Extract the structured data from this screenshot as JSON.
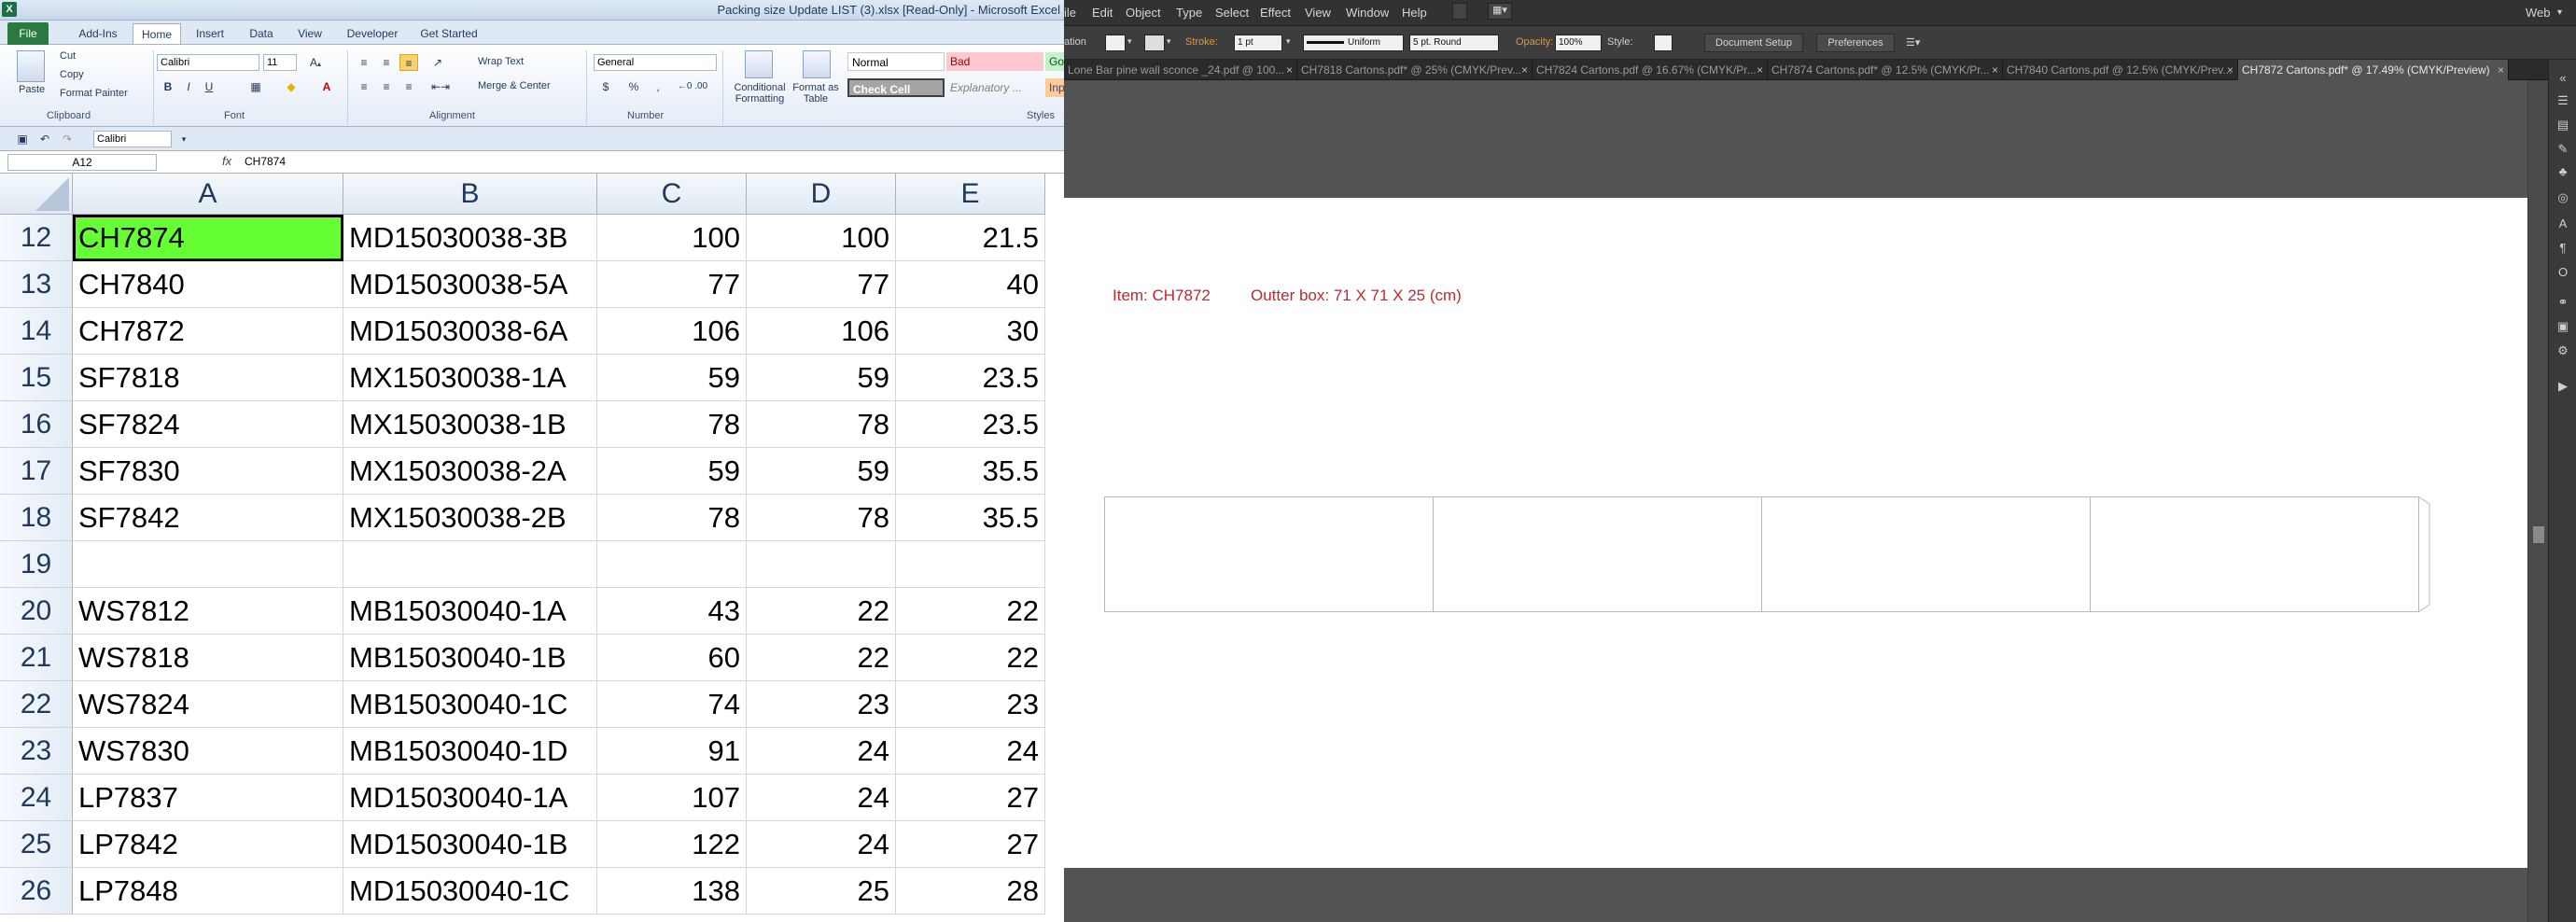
{
  "excel": {
    "window_title": "Packing size Update LIST (3).xlsx  [Read-Only]  -  Microsoft Excel",
    "tabs": [
      "File",
      "Add-Ins",
      "Home",
      "Insert",
      "Data",
      "View",
      "Developer",
      "Get Started"
    ],
    "active_tab": "Home",
    "ribbon": {
      "clipboard": {
        "paste": "Paste",
        "cut": "Cut",
        "copy": "Copy",
        "format_painter": "Format Painter",
        "label": "Clipboard"
      },
      "font": {
        "name": "Calibri",
        "size": "11",
        "label": "Font"
      },
      "alignment": {
        "wrap_text": "Wrap Text",
        "merge_center": "Merge & Center",
        "label": "Alignment"
      },
      "number": {
        "format": "General",
        "currency": "$",
        "percent": "%",
        "comma": ",",
        "label": "Number"
      },
      "styles": {
        "conditional": "Conditional Formatting",
        "format_table": "Format as Table",
        "normal": "Normal",
        "bad": "Bad",
        "good": "Go",
        "check_cell": "Check Cell",
        "explanatory": "Explanatory ...",
        "input": "Inp",
        "label": "Styles"
      }
    },
    "qat_font": "Calibri",
    "name_box": "A12",
    "fx_label": "fx",
    "formula_value": "CH7874",
    "columns": [
      "A",
      "B",
      "C",
      "D",
      "E"
    ],
    "rows": [
      {
        "num": "12",
        "a": "CH7874",
        "b": "MD15030038-3B",
        "c": "100",
        "d": "100",
        "e": "21.5"
      },
      {
        "num": "13",
        "a": "CH7840",
        "b": "MD15030038-5A",
        "c": "77",
        "d": "77",
        "e": "40"
      },
      {
        "num": "14",
        "a": "CH7872",
        "b": "MD15030038-6A",
        "c": "106",
        "d": "106",
        "e": "30"
      },
      {
        "num": "15",
        "a": "SF7818",
        "b": "MX15030038-1A",
        "c": "59",
        "d": "59",
        "e": "23.5"
      },
      {
        "num": "16",
        "a": "SF7824",
        "b": "MX15030038-1B",
        "c": "78",
        "d": "78",
        "e": "23.5"
      },
      {
        "num": "17",
        "a": "SF7830",
        "b": "MX15030038-2A",
        "c": "59",
        "d": "59",
        "e": "35.5"
      },
      {
        "num": "18",
        "a": "SF7842",
        "b": "MX15030038-2B",
        "c": "78",
        "d": "78",
        "e": "35.5"
      },
      {
        "num": "19",
        "a": "",
        "b": "",
        "c": "",
        "d": "",
        "e": ""
      },
      {
        "num": "20",
        "a": "WS7812",
        "b": "MB15030040-1A",
        "c": "43",
        "d": "22",
        "e": "22"
      },
      {
        "num": "21",
        "a": "WS7818",
        "b": "MB15030040-1B",
        "c": "60",
        "d": "22",
        "e": "22"
      },
      {
        "num": "22",
        "a": "WS7824",
        "b": "MB15030040-1C",
        "c": "74",
        "d": "23",
        "e": "23"
      },
      {
        "num": "23",
        "a": "WS7830",
        "b": "MB15030040-1D",
        "c": "91",
        "d": "24",
        "e": "24"
      },
      {
        "num": "24",
        "a": "LP7837",
        "b": "MD15030040-1A",
        "c": "107",
        "d": "24",
        "e": "27"
      },
      {
        "num": "25",
        "a": "LP7842",
        "b": "MD15030040-1B",
        "c": "122",
        "d": "24",
        "e": "27"
      },
      {
        "num": "26",
        "a": "LP7848",
        "b": "MD15030040-1C",
        "c": "138",
        "d": "25",
        "e": "28"
      }
    ],
    "highlight_color": "#66ff33"
  },
  "illustrator": {
    "menus": [
      "ile",
      "Edit",
      "Object",
      "Type",
      "Select",
      "Effect",
      "View",
      "Window",
      "Help"
    ],
    "workspace": "Web",
    "control": {
      "selection_label": "ation",
      "stroke_label": "Stroke:",
      "stroke_weight": "1 pt",
      "profile": "Uniform",
      "brush": "5 pt. Round",
      "opacity_label": "Opacity:",
      "opacity_value": "100%",
      "style_label": "Style:",
      "document_setup": "Document Setup",
      "preferences": "Preferences"
    },
    "doc_tabs": [
      {
        "label": "Lone Bar pine wall sconce _24.pdf @ 100...",
        "active": false
      },
      {
        "label": "CH7818 Cartons.pdf* @ 25% (CMYK/Prev...",
        "active": false
      },
      {
        "label": "CH7824 Cartons.pdf @ 16.67% (CMYK/Pr...",
        "active": false
      },
      {
        "label": "CH7874 Cartons.pdf* @ 12.5% (CMYK/Pr...",
        "active": false
      },
      {
        "label": "CH7840 Cartons.pdf @ 12.5% (CMYK/Prev...",
        "active": false
      },
      {
        "label": "CH7872 Cartons.pdf* @ 17.49% (CMYK/Preview)",
        "active": true
      }
    ],
    "tab_close": "×",
    "artboard": {
      "item_label": "Item: CH7872",
      "outer_box_label": "Outter box:  71 X 71 X 25 (cm)",
      "label_color": "#c1272d"
    }
  }
}
